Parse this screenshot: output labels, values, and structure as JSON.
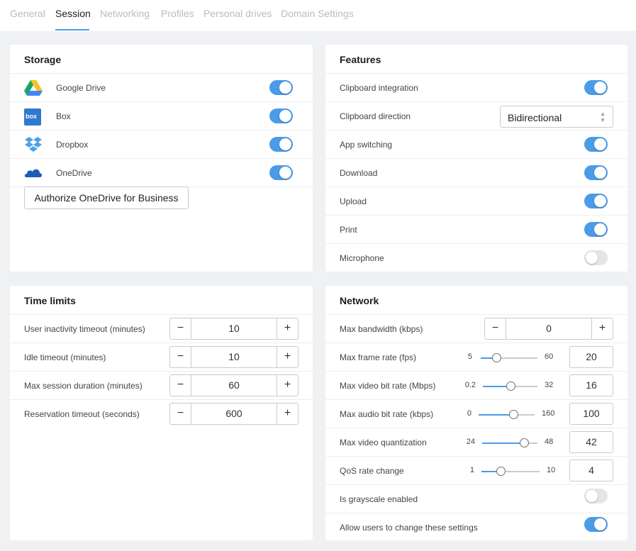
{
  "tabs": [
    {
      "label": "General",
      "active": false
    },
    {
      "label": "Session",
      "active": true
    },
    {
      "label": "Networking",
      "active": false
    },
    {
      "label": "Profiles",
      "active": false
    },
    {
      "label": "Personal drives",
      "active": false
    },
    {
      "label": "Domain Settings",
      "active": false
    }
  ],
  "colors": {
    "accent": "#4a9be8",
    "toggle_off": "#e4e5e7",
    "background": "#f0f1f3"
  },
  "storage": {
    "title": "Storage",
    "items": [
      {
        "label": "Google Drive",
        "icon": "google-drive-icon",
        "enabled": true
      },
      {
        "label": "Box",
        "icon": "box-icon",
        "enabled": true
      },
      {
        "label": "Dropbox",
        "icon": "dropbox-icon",
        "enabled": true
      },
      {
        "label": "OneDrive",
        "icon": "onedrive-icon",
        "enabled": true
      }
    ],
    "authorize_label": "Authorize OneDrive for Business",
    "box_icon_text": "box"
  },
  "features": {
    "title": "Features",
    "clipboard_integration": {
      "label": "Clipboard integration",
      "enabled": true
    },
    "clipboard_direction": {
      "label": "Clipboard direction",
      "value": "Bidirectional"
    },
    "app_switching": {
      "label": "App switching",
      "enabled": true
    },
    "download": {
      "label": "Download",
      "enabled": true
    },
    "upload": {
      "label": "Upload",
      "enabled": true
    },
    "print": {
      "label": "Print",
      "enabled": true
    },
    "microphone": {
      "label": "Microphone",
      "enabled": false
    }
  },
  "time_limits": {
    "title": "Time limits",
    "items": [
      {
        "label": "User inactivity timeout (minutes)",
        "value": "10"
      },
      {
        "label": "Idle timeout (minutes)",
        "value": "10"
      },
      {
        "label": "Max session duration (minutes)",
        "value": "60"
      },
      {
        "label": "Reservation timeout (seconds)",
        "value": "600"
      }
    ]
  },
  "stepper_symbols": {
    "minus": "−",
    "plus": "+"
  },
  "network": {
    "title": "Network",
    "max_bandwidth": {
      "label": "Max bandwidth (kbps)",
      "value": "0"
    },
    "sliders": [
      {
        "label": "Max frame rate (fps)",
        "min": "5",
        "max": "60",
        "value": "20",
        "fraction": 0.27
      },
      {
        "label": "Max video bit rate (Mbps)",
        "min": "0.2",
        "max": "32",
        "value": "16",
        "fraction": 0.5
      },
      {
        "label": "Max audio bit rate (kbps)",
        "min": "0",
        "max": "160",
        "value": "100",
        "fraction": 0.62
      },
      {
        "label": "Max video quantization",
        "min": "24",
        "max": "48",
        "value": "42",
        "fraction": 0.75
      },
      {
        "label": "QoS rate change",
        "min": "1",
        "max": "10",
        "value": "4",
        "fraction": 0.33
      }
    ],
    "is_grayscale": {
      "label": "Is grayscale enabled",
      "enabled": false
    },
    "allow_users": {
      "label": "Allow users to change these settings",
      "enabled": true
    }
  }
}
